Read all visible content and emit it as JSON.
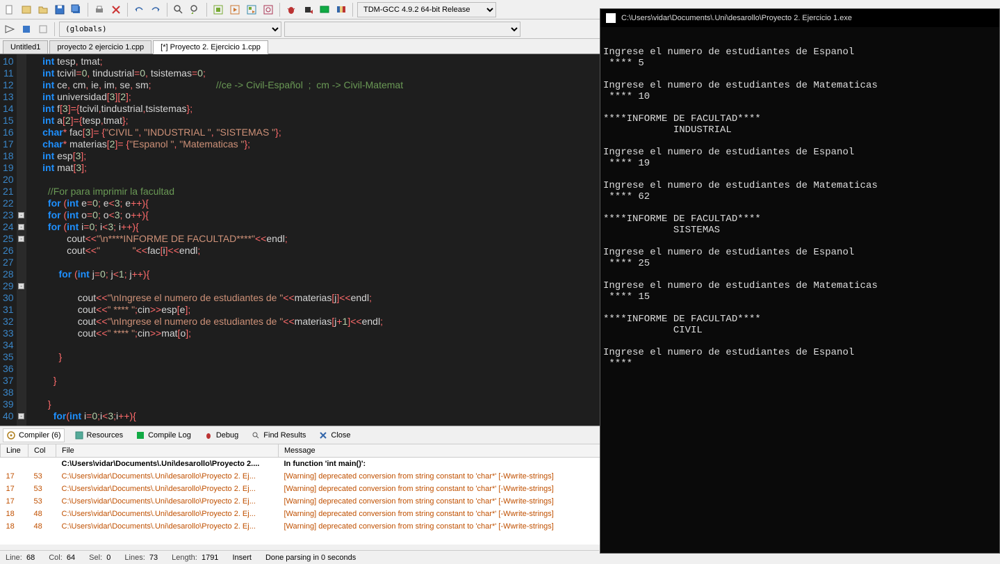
{
  "compiler_selector": "TDM-GCC 4.9.2 64-bit Release",
  "globals_selector": "(globals)",
  "file_tabs": [
    {
      "label": "Untitled1",
      "active": false
    },
    {
      "label": "proyecto 2 ejercicio 1.cpp",
      "active": false
    },
    {
      "label": "[*] Proyecto 2. Ejercicio 1.cpp",
      "active": true
    }
  ],
  "editor": {
    "first_line": 10,
    "fold_marks": {
      "23": true,
      "24": true,
      "25": true,
      "29": true,
      "40": true
    },
    "code_html": [
      "    <span class='ty'>int</span> tesp<span class='op'>,</span> tmat<span class='op'>;</span>",
      "    <span class='ty'>int</span> tcivil<span class='op'>=</span><span class='num'>0</span><span class='op'>,</span> tindustrial<span class='op'>=</span><span class='num'>0</span><span class='op'>,</span> tsistemas<span class='op'>=</span><span class='num'>0</span><span class='op'>;</span>",
      "    <span class='ty'>int</span> ce<span class='op'>,</span> cm<span class='op'>,</span> ie<span class='op'>,</span> im<span class='op'>,</span> se<span class='op'>,</span> sm<span class='op'>;</span>                        <span class='cmt'>//ce -> Civil-Español  ;  cm -> Civil-Matemat</span>",
      "    <span class='ty'>int</span> universidad<span class='op'>[</span><span class='num'>3</span><span class='op'>][</span><span class='num'>2</span><span class='op'>];</span>",
      "    <span class='ty'>int</span> f<span class='op'>[</span><span class='num'>3</span><span class='op'>]={</span>tcivil<span class='op'>,</span>tindustrial<span class='op'>,</span>tsistemas<span class='op'>};</span>",
      "    <span class='ty'>int</span> a<span class='op'>[</span><span class='num'>2</span><span class='op'>]={</span>tesp<span class='op'>,</span>tmat<span class='op'>};</span>",
      "    <span class='ty'>char</span><span class='op'>*</span> fac<span class='op'>[</span><span class='num'>3</span><span class='op'>]= {</span><span class='str'>\"CIVIL \"</span><span class='op'>,</span> <span class='str'>\"INDUSTRIAL \"</span><span class='op'>,</span> <span class='str'>\"SISTEMAS \"</span><span class='op'>};</span>",
      "    <span class='ty'>char</span><span class='op'>*</span> materias<span class='op'>[</span><span class='num'>2</span><span class='op'>]= {</span><span class='str'>\"Espanol \"</span><span class='op'>,</span> <span class='str'>\"Matematicas \"</span><span class='op'>};</span>",
      "    <span class='ty'>int</span> esp<span class='op'>[</span><span class='num'>3</span><span class='op'>];</span>",
      "    <span class='ty'>int</span> mat<span class='op'>[</span><span class='num'>3</span><span class='op'>];</span>",
      "",
      "      <span class='cmt'>//For para imprimir la facultad</span>",
      "      <span class='kw'>for</span> <span class='op'>(</span><span class='ty'>int</span> e<span class='op'>=</span><span class='num'>0</span><span class='op'>;</span> e<span class='op'>&lt;</span><span class='num'>3</span><span class='op'>;</span> e<span class='op'>++){</span>",
      "      <span class='kw'>for</span> <span class='op'>(</span><span class='ty'>int</span> o<span class='op'>=</span><span class='num'>0</span><span class='op'>;</span> o<span class='op'>&lt;</span><span class='num'>3</span><span class='op'>;</span> o<span class='op'>++){</span>",
      "      <span class='kw'>for</span> <span class='op'>(</span><span class='ty'>int</span> i<span class='op'>=</span><span class='num'>0</span><span class='op'>;</span> i<span class='op'>&lt;</span><span class='num'>3</span><span class='op'>;</span> i<span class='op'>++){</span>",
      "             cout<span class='op'>&lt;&lt;</span><span class='str'>\"\\n****INFORME DE FACULTAD****\"</span><span class='op'>&lt;&lt;</span>endl<span class='op'>;</span>",
      "             cout<span class='op'>&lt;&lt;</span><span class='str'>\"            \"</span><span class='op'>&lt;&lt;</span>fac<span class='op'>[</span>i<span class='op'>]&lt;&lt;</span>endl<span class='op'>;</span>",
      "",
      "          <span class='kw'>for</span> <span class='op'>(</span><span class='ty'>int</span> j<span class='op'>=</span><span class='num'>0</span><span class='op'>;</span> j<span class='op'>&lt;</span><span class='num'>1</span><span class='op'>;</span> j<span class='op'>++){</span>",
      "",
      "                 cout<span class='op'>&lt;&lt;</span><span class='str'>\"\\nIngrese el numero de estudiantes de \"</span><span class='op'>&lt;&lt;</span>materias<span class='op'>[</span>j<span class='op'>]&lt;&lt;</span>endl<span class='op'>;</span>",
      "                 cout<span class='op'>&lt;&lt;</span><span class='str'>\" **** \"</span><span class='op'>;</span>cin<span class='op'>&gt;&gt;</span>esp<span class='op'>[</span>e<span class='op'>];</span>",
      "                 cout<span class='op'>&lt;&lt;</span><span class='str'>\"\\nIngrese el numero de estudiantes de \"</span><span class='op'>&lt;&lt;</span>materias<span class='op'>[</span>j<span class='op'>+</span><span class='num'>1</span><span class='op'>]&lt;&lt;</span>endl<span class='op'>;</span>",
      "                 cout<span class='op'>&lt;&lt;</span><span class='str'>\" **** \"</span><span class='op'>;</span>cin<span class='op'>&gt;&gt;</span>mat<span class='op'>[</span>o<span class='op'>];</span>",
      "",
      "          <span class='op'>}</span>",
      "",
      "        <span class='op'>}</span>",
      "",
      "      <span class='op'>}</span>",
      "        <span class='kw'>for</span><span class='op'>(</span><span class='ty'>int</span> i<span class='op'>=</span><span class='num'>0</span><span class='op'>;</span>i<span class='op'>&lt;</span><span class='num'>3</span><span class='op'>;</span>i<span class='op'>++){</span>"
    ]
  },
  "bottom_tabs": {
    "compiler": "Compiler (6)",
    "resources": "Resources",
    "compile_log": "Compile Log",
    "debug": "Debug",
    "find_results": "Find Results",
    "close": "Close"
  },
  "compiler_cols": {
    "line": "Line",
    "col": "Col",
    "file": "File",
    "message": "Message"
  },
  "compiler_hdr": {
    "file": "C:\\Users\\vidar\\Documents\\.Uni\\desarollo\\Proyecto 2....",
    "msg": "In function 'int main()':"
  },
  "compiler_rows": [
    {
      "line": "17",
      "col": "53",
      "file": "C:\\Users\\vidar\\Documents\\.Uni\\desarollo\\Proyecto 2. Ej...",
      "msg": "[Warning] deprecated conversion from string constant to 'char*' [-Wwrite-strings]"
    },
    {
      "line": "17",
      "col": "53",
      "file": "C:\\Users\\vidar\\Documents\\.Uni\\desarollo\\Proyecto 2. Ej...",
      "msg": "[Warning] deprecated conversion from string constant to 'char*' [-Wwrite-strings]"
    },
    {
      "line": "17",
      "col": "53",
      "file": "C:\\Users\\vidar\\Documents\\.Uni\\desarollo\\Proyecto 2. Ej...",
      "msg": "[Warning] deprecated conversion from string constant to 'char*' [-Wwrite-strings]"
    },
    {
      "line": "18",
      "col": "48",
      "file": "C:\\Users\\vidar\\Documents\\.Uni\\desarollo\\Proyecto 2. Ej...",
      "msg": "[Warning] deprecated conversion from string constant to 'char*' [-Wwrite-strings]"
    },
    {
      "line": "18",
      "col": "48",
      "file": "C:\\Users\\vidar\\Documents\\.Uni\\desarollo\\Proyecto 2. Ej...",
      "msg": "[Warning] deprecated conversion from string constant to 'char*' [-Wwrite-strings]"
    }
  ],
  "statusbar": {
    "line_label": "Line:",
    "line": "68",
    "col_label": "Col:",
    "col": "64",
    "sel_label": "Sel:",
    "sel": "0",
    "lines_label": "Lines:",
    "lines": "73",
    "length_label": "Length:",
    "length": "1791",
    "insert": "Insert",
    "parse": "Done parsing in 0 seconds"
  },
  "console": {
    "title": "C:\\Users\\vidar\\Documents\\.Uni\\desarollo\\Proyecto 2. Ejercicio 1.exe",
    "output": "Ingrese el numero de estudiantes de Espanol\n **** 5\n\nIngrese el numero de estudiantes de Matematicas\n **** 10\n\n****INFORME DE FACULTAD****\n            INDUSTRIAL\n\nIngrese el numero de estudiantes de Espanol\n **** 19\n\nIngrese el numero de estudiantes de Matematicas\n **** 62\n\n****INFORME DE FACULTAD****\n            SISTEMAS\n\nIngrese el numero de estudiantes de Espanol\n **** 25\n\nIngrese el numero de estudiantes de Matematicas\n **** 15\n\n****INFORME DE FACULTAD****\n            CIVIL\n\nIngrese el numero de estudiantes de Espanol\n **** "
  }
}
